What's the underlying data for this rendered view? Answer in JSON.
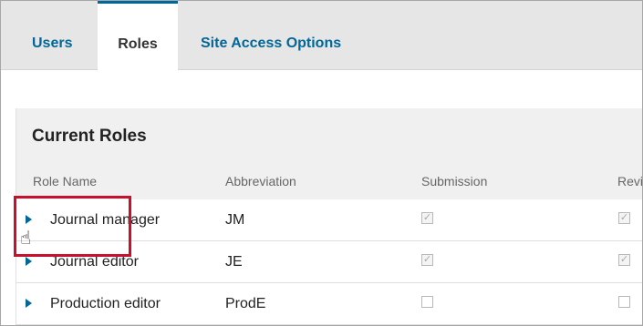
{
  "tabs": [
    {
      "label": "Users"
    },
    {
      "label": "Roles"
    },
    {
      "label": "Site Access Options"
    }
  ],
  "panel": {
    "title": "Current Roles",
    "columns": [
      "Role Name",
      "Abbreviation",
      "Submission",
      "Revi"
    ],
    "rows": [
      {
        "name": "Journal manager",
        "abbrev": "JM",
        "submission": true,
        "review": true
      },
      {
        "name": "Journal editor",
        "abbrev": "JE",
        "submission": true,
        "review": true
      },
      {
        "name": "Production editor",
        "abbrev": "ProdE",
        "submission": false,
        "review": false
      }
    ]
  },
  "checkmark_glyph": "✓",
  "icons": [
    "expand-arrow-icon",
    "hand-cursor-icon"
  ],
  "colors": {
    "accent": "#006798",
    "highlight": "#c8102e"
  }
}
